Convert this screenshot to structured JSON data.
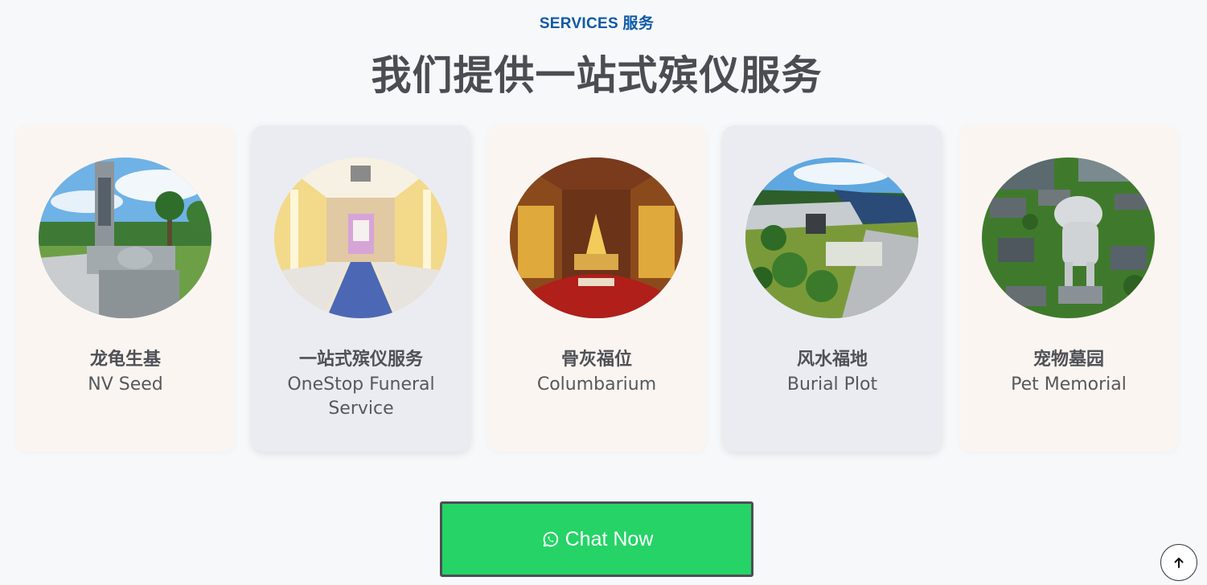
{
  "header": {
    "eyebrow": "SERVICES 服务",
    "title": "我们提供一站式殡仪服务"
  },
  "services": [
    {
      "name_cn": "龙龟生基",
      "name_en": "NV Seed",
      "image": "granite-tomb-garden",
      "tone": "warm"
    },
    {
      "name_cn": "一站式殡仪服务",
      "name_en": "OneStop Funeral Service",
      "image": "funeral-hall",
      "tone": "cool"
    },
    {
      "name_cn": "骨灰福位",
      "name_en": "Columbarium",
      "image": "columbarium-hall",
      "tone": "warm"
    },
    {
      "name_cn": "风水福地",
      "name_en": "Burial Plot",
      "image": "hillside-cemetery",
      "tone": "cool"
    },
    {
      "name_cn": "宠物墓园",
      "name_en": "Pet Memorial",
      "image": "dog-statue-garden",
      "tone": "warm"
    }
  ],
  "cta": {
    "label": "Chat Now",
    "icon": "whatsapp-icon",
    "color": "#25d366"
  },
  "back_to_top": {
    "icon": "arrow-up-icon"
  },
  "colors": {
    "accent": "#0d5aa7",
    "title": "#4a4d52",
    "card_warm": "#fbf5f1",
    "card_cool": "#ebecf2"
  }
}
